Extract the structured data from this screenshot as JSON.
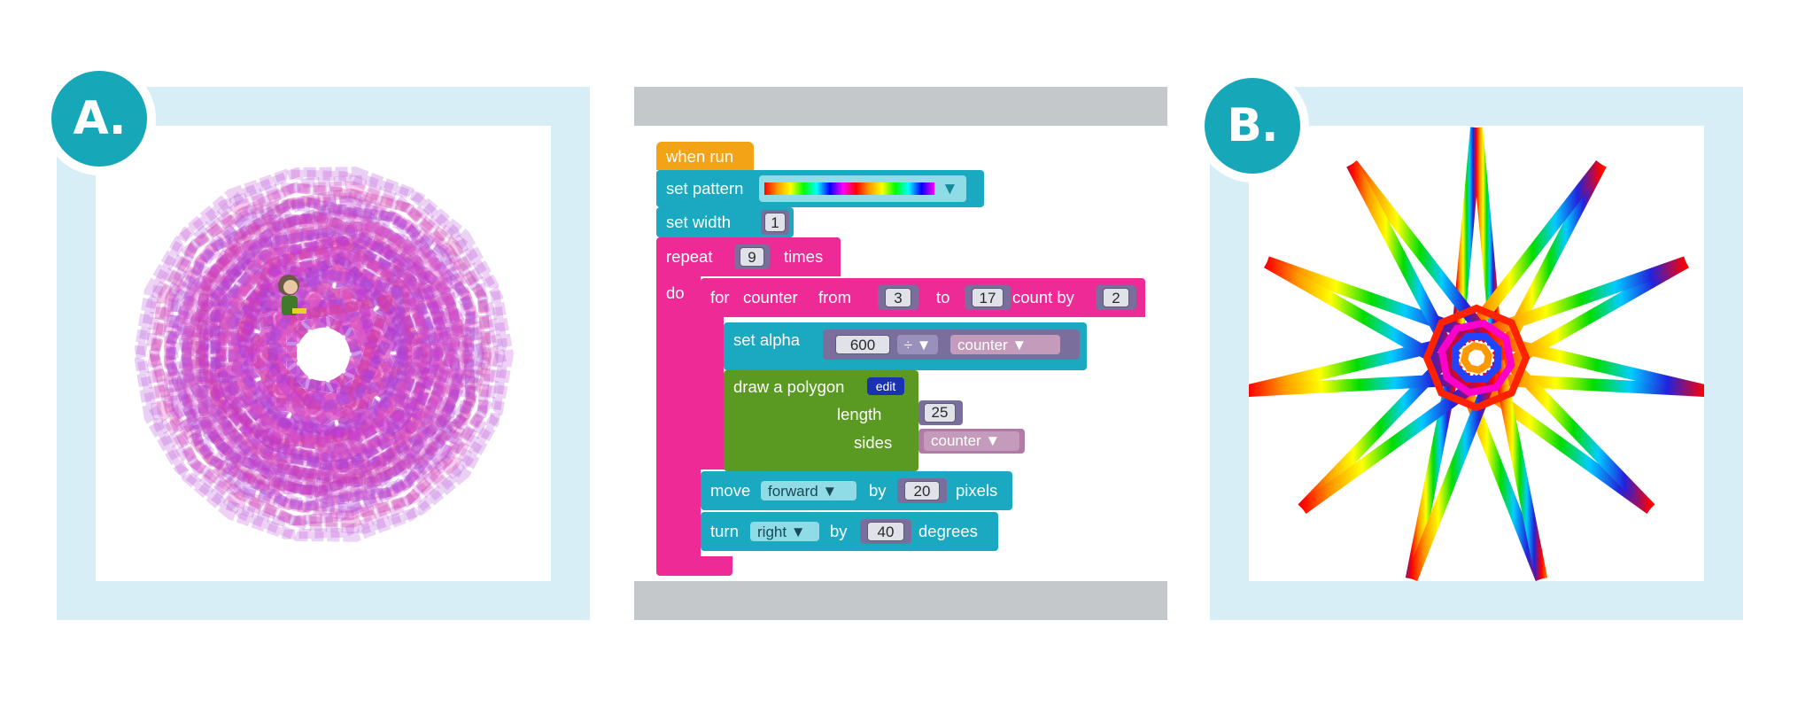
{
  "badges": {
    "a": "A.",
    "b": "B."
  },
  "code": {
    "when_run": "when run",
    "set_pattern": "set pattern",
    "pattern_arrow": "▼",
    "set_width": "set width",
    "width_value": "1",
    "repeat": "repeat",
    "repeat_times": "9",
    "times": "times",
    "do": "do",
    "for_label": "for",
    "counter_var": "counter",
    "from_label": "from",
    "from_value": "3",
    "to_label": "to",
    "to_value": "17",
    "count_by_label": "count by",
    "count_by_value": "2",
    "set_alpha": "set alpha",
    "alpha_numerator": "600",
    "alpha_operator": "÷ ▼",
    "alpha_denominator": "counter ▼",
    "draw_polygon": "draw a polygon",
    "edit": "edit",
    "length_label": "length",
    "length_value": "25",
    "sides_label": "sides",
    "sides_value": "counter ▼",
    "move": "move",
    "move_direction": "forward ▼",
    "by": "by",
    "move_value": "20",
    "pixels": "pixels",
    "turn": "turn",
    "turn_direction": "right ▼",
    "turn_value": "40",
    "degrees": "degrees"
  },
  "colors": {
    "frame": "#d8eef6",
    "badge": "#16a7b8",
    "event_block": "#f2a316",
    "turtle_block": "#1aa9c1",
    "loop_block": "#ee2a96",
    "math_block": "#7a6e9c",
    "variable_block": "#b07ba6",
    "draw_block": "#5a9a22",
    "edit_button": "#1a32b0",
    "divider_bar": "#c4c8ca"
  }
}
